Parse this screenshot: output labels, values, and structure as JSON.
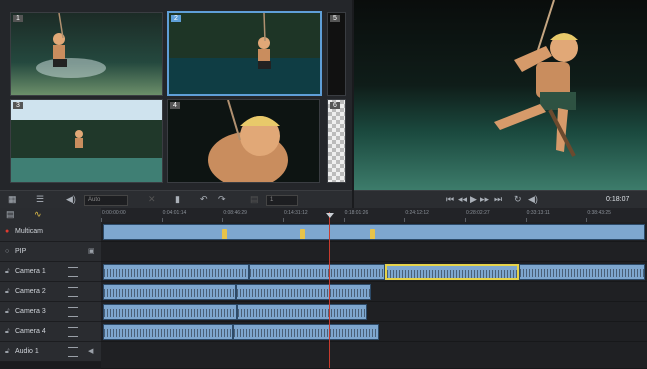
{
  "multicam_grid": {
    "cameras": [
      {
        "num": "1"
      },
      {
        "num": "2"
      },
      {
        "num": "3"
      },
      {
        "num": "4"
      },
      {
        "num": "5"
      },
      {
        "num": "6"
      }
    ]
  },
  "controls_left": {
    "audio_dropdown": "Auto",
    "field_value": "1"
  },
  "controls_right": {
    "timecode": "0:18:07"
  },
  "ruler": {
    "ticks": [
      "0:00:00:00",
      "0:04:01:14",
      "0:08:46:29",
      "0:14:31:12",
      "0:18:01:26",
      "0:24:12:12",
      "0:28:02:27",
      "0:33:13:11",
      "0:38:43:25"
    ]
  },
  "tracks": [
    {
      "name": "Multicam"
    },
    {
      "name": "PIP"
    },
    {
      "name": "Camera 1"
    },
    {
      "name": "Camera 2"
    },
    {
      "name": "Camera 3"
    },
    {
      "name": "Camera 4"
    },
    {
      "name": "Audio 1"
    }
  ],
  "colors": {
    "accent": "#5f9fd8",
    "clip": "#7ea7cf",
    "playhead": "#c73b2e",
    "record": "#e03a2f",
    "selection": "#e6d34a"
  }
}
